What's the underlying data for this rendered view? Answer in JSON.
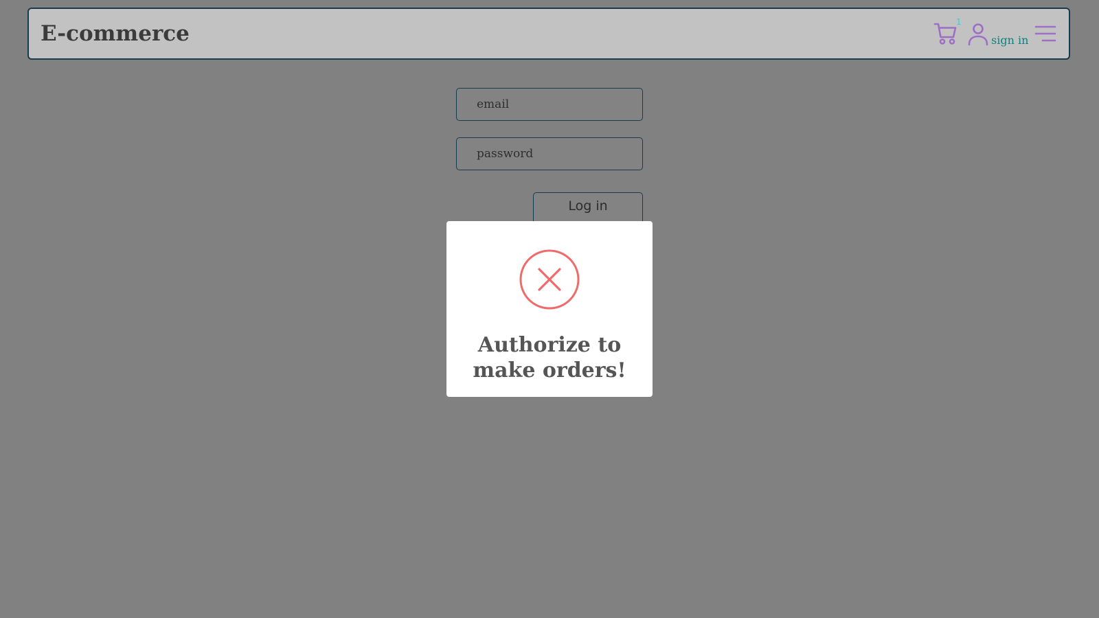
{
  "header": {
    "logo": "E-commerce",
    "cart_icon": "shopping-cart-icon",
    "cart_count": "1",
    "user_icon": "user-icon",
    "sign_in_label": "sign in",
    "menu_icon": "hamburger-menu-icon"
  },
  "login_form": {
    "email_placeholder": "email",
    "email_value": "",
    "password_placeholder": "password",
    "password_value": "",
    "login_label": "Log in"
  },
  "modal": {
    "icon": "error-x-circle-icon",
    "message": "Authorize to make orders!"
  },
  "colors": {
    "page_background": "#818181",
    "header_background": "#c2c2c2",
    "header_border": "#183b4e",
    "icon_purple": "#9e6ec4",
    "sign_in_text": "#0f8080",
    "cart_badge": "#27d3e6",
    "error_red": "#ef6b6b",
    "modal_background": "#ffffff"
  }
}
